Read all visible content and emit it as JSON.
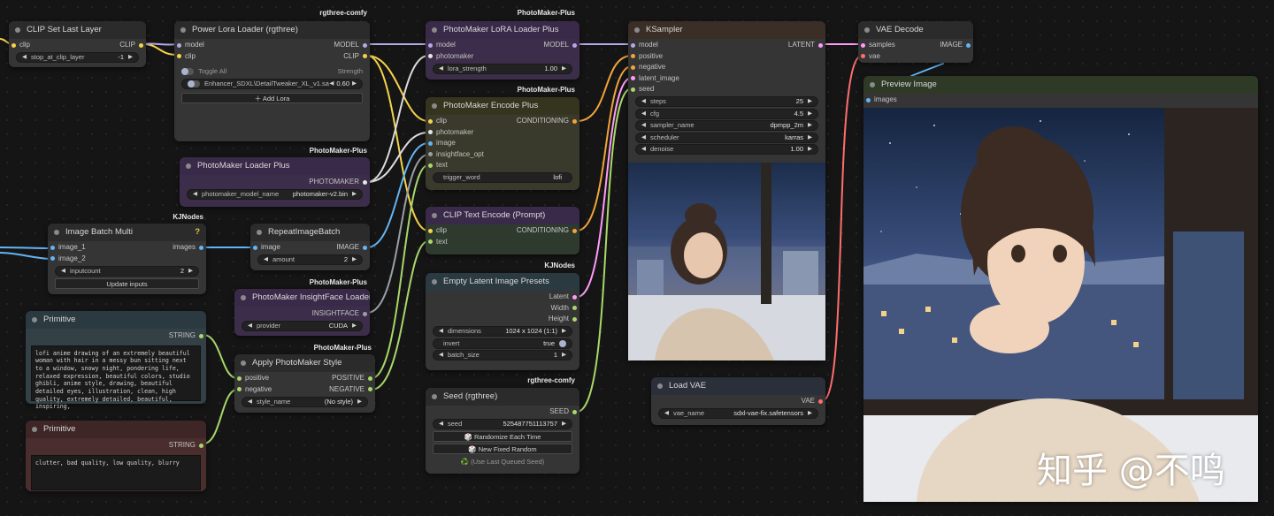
{
  "colors": {
    "clip": "#f5d34a",
    "model": "#b7a7e6",
    "conditioning": "#f2a43b",
    "latent": "#ff9cf9",
    "image": "#64b5f6",
    "vae": "#ff6e6e",
    "string": "#a8d86b",
    "photomaker": "#e6e6e6",
    "seed": "#a8d86b"
  },
  "clip_set": {
    "title": "CLIP Set Last Layer",
    "in_clip": "clip",
    "out_clip": "CLIP",
    "w_label": "stop_at_clip_layer",
    "w_value": "-1"
  },
  "lora": {
    "badge": "rgthree-comfy",
    "title": "Power Lora Loader (rgthree)",
    "in_model": "model",
    "in_clip": "clip",
    "out_model": "MODEL",
    "out_clip": "CLIP",
    "toggle_all": "Toggle All",
    "strength": "Strength",
    "lora_name": "Enhancer_SDXL\\DetailTweaker_XL_v1.saf...",
    "lora_strength": "0.60",
    "add_lora": "Add Lora"
  },
  "pm_loader": {
    "badge": "PhotoMaker-Plus",
    "title": "PhotoMaker Loader Plus",
    "out": "PHOTOMAKER",
    "w_label": "photomaker_model_name",
    "w_value": "photomaker-v2.bin"
  },
  "batch": {
    "badge": "KJNodes",
    "title": "Image Batch Multi",
    "help": "?",
    "in1": "image_1",
    "in2": "image_2",
    "out": "images",
    "w_label": "inputcount",
    "w_value": "2",
    "btn": "Update inputs"
  },
  "repeat": {
    "title": "RepeatImageBatch",
    "in": "image",
    "out": "IMAGE",
    "w_label": "amount",
    "w_value": "2"
  },
  "insight": {
    "badge": "PhotoMaker-Plus",
    "title": "PhotoMaker InsightFace Loader",
    "out": "INSIGHTFACE",
    "w_label": "provider",
    "w_value": "CUDA"
  },
  "prim1": {
    "title": "Primitive",
    "out": "STRING",
    "text": "lofi anime drawing of an extremely beautiful woman with hair in a messy bun sitting next to a window, snowy night, pondering life, relaxed expression, beautiful colors, studio ghibli, anime style, drawing, beautiful detailed eyes, illustration, clean, high quality, extremely detailed, beautiful, inspiring,"
  },
  "prim2": {
    "title": "Primitive",
    "out": "STRING",
    "text": "clutter, bad quality, low quality, blurry"
  },
  "style": {
    "badge": "PhotoMaker-Plus",
    "title": "Apply PhotoMaker Style",
    "in_pos": "positive",
    "in_neg": "negative",
    "out_pos": "POSITIVE",
    "out_neg": "NEGATIVE",
    "w_label": "style_name",
    "w_value": "(No style)"
  },
  "pm_lora": {
    "badge": "PhotoMaker-Plus",
    "title": "PhotoMaker LoRA Loader Plus",
    "in_model": "model",
    "in_pm": "photomaker",
    "out": "MODEL",
    "w_label": "lora_strength",
    "w_value": "1.00"
  },
  "encode": {
    "badge": "PhotoMaker-Plus",
    "title": "PhotoMaker Encode Plus",
    "in_clip": "clip",
    "in_pm": "photomaker",
    "in_image": "image",
    "in_if": "insightface_opt",
    "in_text": "text",
    "out": "CONDITIONING",
    "w_label": "trigger_word",
    "w_value": "lofi"
  },
  "clip_text": {
    "title": "CLIP Text Encode (Prompt)",
    "in_clip": "clip",
    "in_text": "text",
    "out": "CONDITIONING"
  },
  "latent": {
    "badge": "KJNodes",
    "title": "Empty Latent Image Presets",
    "out_latent": "Latent",
    "out_w": "Width",
    "out_h": "Height",
    "w1_label": "dimensions",
    "w1_value": "1024 x 1024 (1:1)",
    "w2_label": "invert",
    "w2_value": "true",
    "w3_label": "batch_size",
    "w3_value": "1"
  },
  "seed": {
    "badge": "rgthree-comfy",
    "title": "Seed (rgthree)",
    "out": "SEED",
    "w_label": "seed",
    "w_value": "525487751113757",
    "btn1": "🎲 Randomize Each Time",
    "btn2": "🎲 New Fixed Random",
    "btn3": "♻️ (Use Last Queued Seed)"
  },
  "ksampler": {
    "title": "KSampler",
    "in_model": "model",
    "in_pos": "positive",
    "in_neg": "negative",
    "in_latent": "latent_image",
    "in_seed": "seed",
    "out": "LATENT",
    "steps_label": "steps",
    "steps": "25",
    "cfg_label": "cfg",
    "cfg": "4.5",
    "sampler_label": "sampler_name",
    "sampler": "dpmpp_2m",
    "scheduler_label": "scheduler",
    "scheduler": "karras",
    "denoise_label": "denoise",
    "denoise": "1.00"
  },
  "vae_decode": {
    "title": "VAE Decode",
    "in_samples": "samples",
    "in_vae": "vae",
    "out": "IMAGE"
  },
  "preview": {
    "title": "Preview Image",
    "in": "images"
  },
  "load_vae": {
    "title": "Load VAE",
    "out": "VAE",
    "w_label": "vae_name",
    "w_value": "sdxl-vae-fix.safetensors"
  },
  "watermark": "知乎 @不鸣"
}
